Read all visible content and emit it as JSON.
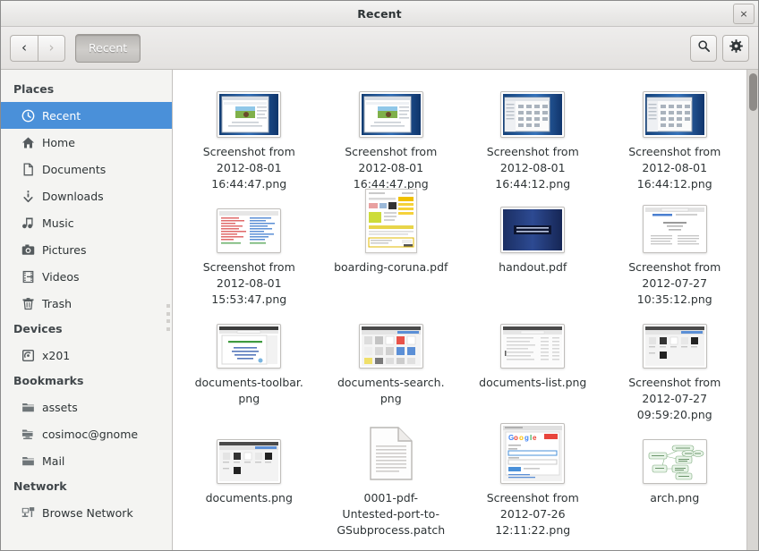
{
  "window": {
    "title": "Recent",
    "close_label": "×"
  },
  "toolbar": {
    "back_glyph": "‹",
    "forward_glyph": "›",
    "breadcrumb_label": "Recent",
    "search_icon": "search-icon",
    "gear_icon": "gear-icon"
  },
  "sidebar": {
    "sections": [
      {
        "title": "Places",
        "items": [
          {
            "label": "Recent",
            "icon": "clock-icon",
            "selected": true
          },
          {
            "label": "Home",
            "icon": "home-icon",
            "selected": false
          },
          {
            "label": "Documents",
            "icon": "document-icon",
            "selected": false
          },
          {
            "label": "Downloads",
            "icon": "download-icon",
            "selected": false
          },
          {
            "label": "Music",
            "icon": "music-icon",
            "selected": false
          },
          {
            "label": "Pictures",
            "icon": "camera-icon",
            "selected": false
          },
          {
            "label": "Videos",
            "icon": "film-icon",
            "selected": false
          },
          {
            "label": "Trash",
            "icon": "trash-icon",
            "selected": false
          }
        ]
      },
      {
        "title": "Devices",
        "items": [
          {
            "label": "x201",
            "icon": "drive-icon",
            "selected": false
          }
        ]
      },
      {
        "title": "Bookmarks",
        "items": [
          {
            "label": "assets",
            "icon": "folder-icon",
            "selected": false
          },
          {
            "label": "cosimoc@gnome",
            "icon": "remote-folder-icon",
            "selected": false
          },
          {
            "label": "Mail",
            "icon": "folder-icon",
            "selected": false
          }
        ]
      },
      {
        "title": "Network",
        "items": [
          {
            "label": "Browse Network",
            "icon": "network-icon",
            "selected": false
          }
        ]
      }
    ]
  },
  "files": [
    {
      "name": "Screenshot from\n2012-08-01\n16:44:47.png",
      "thumb": "screenshot-browser"
    },
    {
      "name": "Screenshot from\n2012-08-01\n16:44:47.png",
      "thumb": "screenshot-browser"
    },
    {
      "name": "Screenshot from\n2012-08-01\n16:44:12.png",
      "thumb": "screenshot-grid"
    },
    {
      "name": "Screenshot from\n2012-08-01\n16:44:12.png",
      "thumb": "screenshot-grid"
    },
    {
      "name": "Screenshot from\n2012-08-01\n15:53:47.png",
      "thumb": "screenshot-code"
    },
    {
      "name": "boarding-coruna.pdf",
      "thumb": "pdf-boarding"
    },
    {
      "name": "handout.pdf",
      "thumb": "pdf-handout"
    },
    {
      "name": "Screenshot from\n2012-07-27\n10:35:12.png",
      "thumb": "screenshot-text"
    },
    {
      "name": "documents-toolbar.\npng",
      "thumb": "screenshot-slide"
    },
    {
      "name": "documents-search.\npng",
      "thumb": "screenshot-docsgrid"
    },
    {
      "name": "documents-list.png",
      "thumb": "screenshot-list"
    },
    {
      "name": "Screenshot from\n2012-07-27\n09:59:20.png",
      "thumb": "screenshot-docs"
    },
    {
      "name": "documents.png",
      "thumb": "screenshot-docs"
    },
    {
      "name": "0001-pdf-\nUntested-port-to-\nGSubprocess.patch",
      "thumb": "text-file"
    },
    {
      "name": "Screenshot from\n2012-07-26\n12:11:22.png",
      "thumb": "screenshot-google"
    },
    {
      "name": "arch.png",
      "thumb": "diagram-arch"
    }
  ],
  "colors": {
    "selection": "#4a90d9",
    "sidebar_bg": "#f4f4f2",
    "toolbar_bg": "#e8e6e4",
    "text": "#2e3436"
  }
}
